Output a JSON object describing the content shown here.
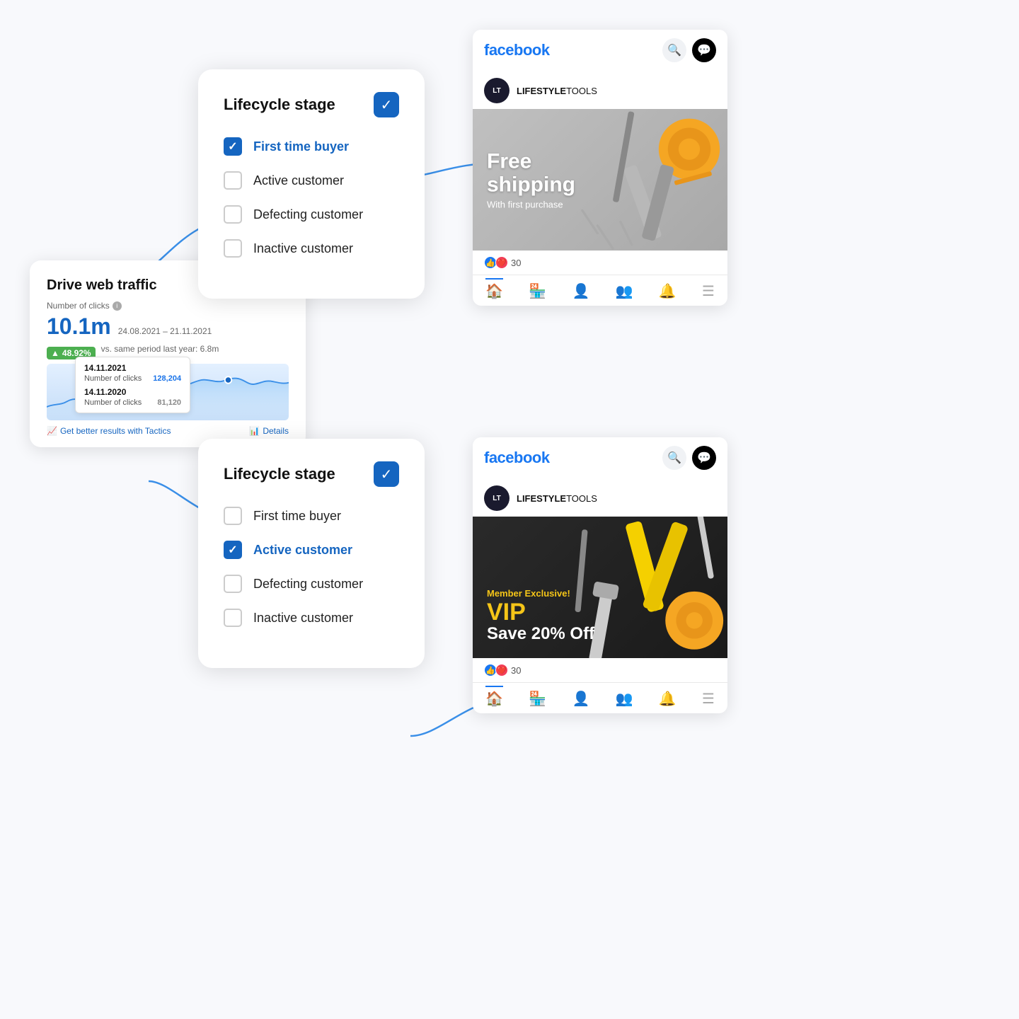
{
  "analytics": {
    "title": "Drive web traffic",
    "label": "Number of clicks",
    "value": "10.1m",
    "date_range": "24.08.2021 – 21.11.2021",
    "badge": "48.92%",
    "comparison": "vs. same period last year: 6.8m",
    "tooltip1": {
      "date": "14.11.2021",
      "label": "Number of clicks",
      "value": "128,204"
    },
    "tooltip2": {
      "date": "14.11.2020",
      "label": "Number of clicks",
      "value": "81,120"
    },
    "footer_tactics": "Get better results with Tactics",
    "footer_details": "Details"
  },
  "lifecycle_top": {
    "title": "Lifecycle stage",
    "items": [
      {
        "label": "First time buyer",
        "checked": true
      },
      {
        "label": "Active customer",
        "checked": false
      },
      {
        "label": "Defecting customer",
        "checked": false
      },
      {
        "label": "Inactive customer",
        "checked": false
      }
    ]
  },
  "lifecycle_bottom": {
    "title": "Lifecycle stage",
    "items": [
      {
        "label": "First time buyer",
        "checked": false
      },
      {
        "label": "Active customer",
        "checked": true
      },
      {
        "label": "Defecting customer",
        "checked": false
      },
      {
        "label": "Inactive customer",
        "checked": false
      }
    ]
  },
  "fb_top": {
    "logo": "facebook",
    "brand": "LIFESTYLETOOLS",
    "brand_logo": "LT",
    "ad_headline": "Free\nshipping",
    "ad_subline": "With first purchase",
    "reactions_count": "30"
  },
  "fb_bottom": {
    "logo": "facebook",
    "brand": "LIFESTYLETOOLS",
    "brand_logo": "LT",
    "vip_headline": "VIP",
    "vip_sub1": "Member Exclusive!",
    "vip_sub2": "Save 20% Off",
    "reactions_count": "30"
  },
  "colors": {
    "facebook_blue": "#1877f2",
    "primary_blue": "#1565c0",
    "green": "#4caf50",
    "vip_yellow": "#f5c518"
  }
}
